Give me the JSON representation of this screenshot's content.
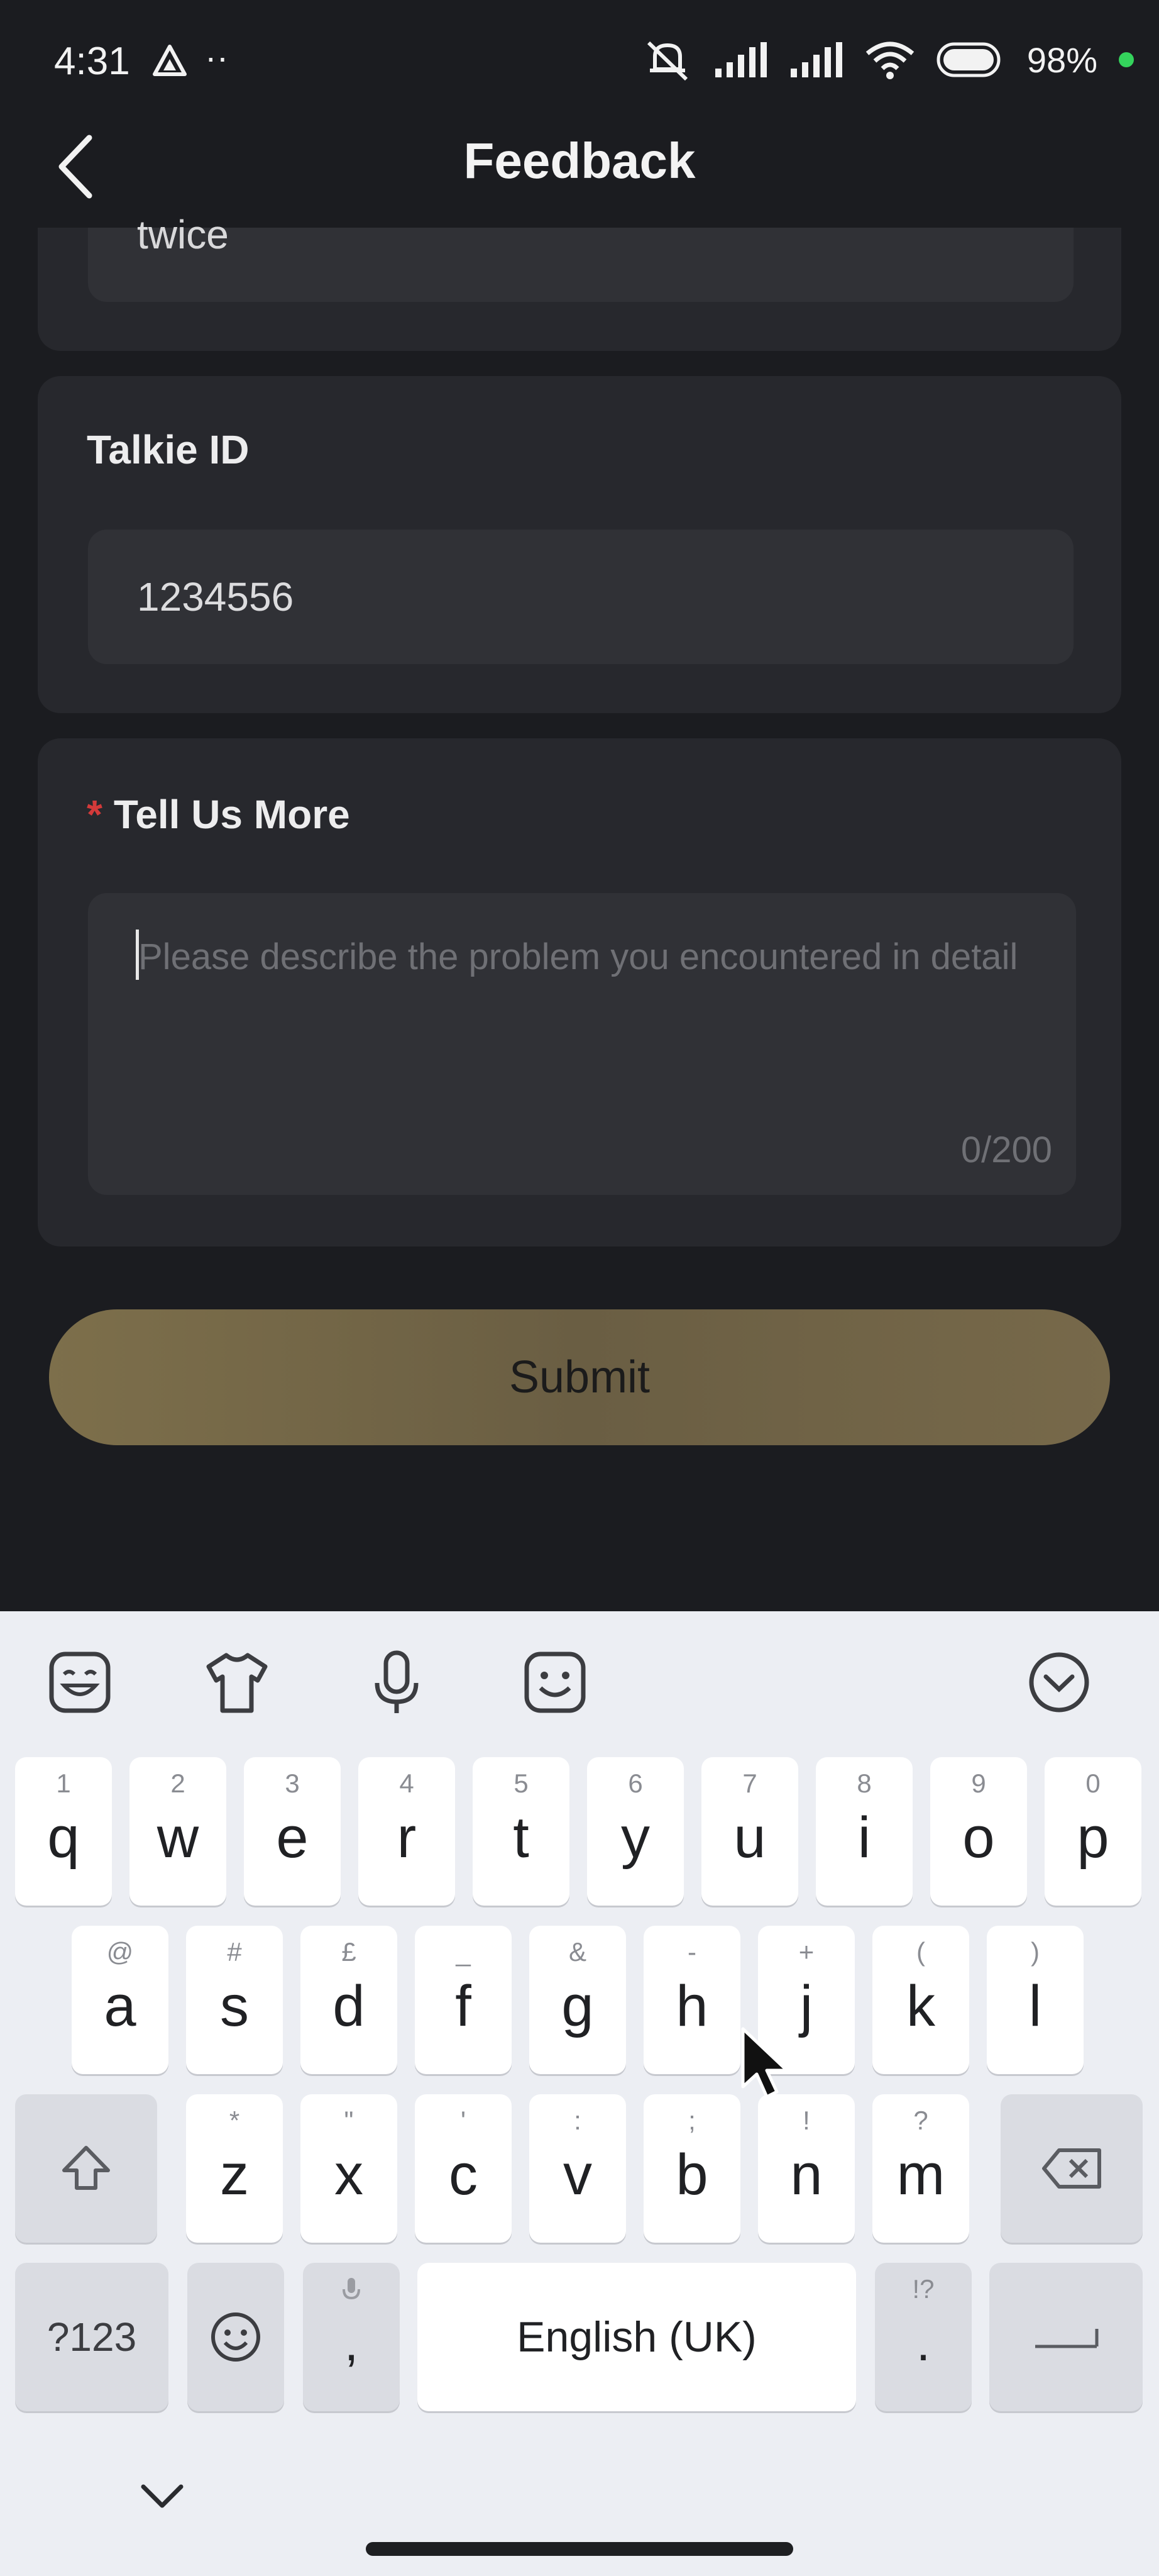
{
  "status_bar": {
    "time": "4:31",
    "dots": "··",
    "battery": "98%"
  },
  "header": {
    "title": "Feedback"
  },
  "prev_field": {
    "value": "twice"
  },
  "talkie": {
    "label": "Talkie ID",
    "value": "1234556"
  },
  "more": {
    "required_mark": "*",
    "label": "Tell Us More",
    "placeholder": "Please describe the problem you encountered in detail",
    "counter": "0/200"
  },
  "submit": {
    "label": "Submit"
  },
  "keyboard": {
    "row1": [
      {
        "k": "q",
        "h": "1"
      },
      {
        "k": "w",
        "h": "2"
      },
      {
        "k": "e",
        "h": "3"
      },
      {
        "k": "r",
        "h": "4"
      },
      {
        "k": "t",
        "h": "5"
      },
      {
        "k": "y",
        "h": "6"
      },
      {
        "k": "u",
        "h": "7"
      },
      {
        "k": "i",
        "h": "8"
      },
      {
        "k": "o",
        "h": "9"
      },
      {
        "k": "p",
        "h": "0"
      }
    ],
    "row2": [
      {
        "k": "a",
        "h": "@"
      },
      {
        "k": "s",
        "h": "#"
      },
      {
        "k": "d",
        "h": "£"
      },
      {
        "k": "f",
        "h": "_"
      },
      {
        "k": "g",
        "h": "&"
      },
      {
        "k": "h",
        "h": "-"
      },
      {
        "k": "j",
        "h": "+"
      },
      {
        "k": "k",
        "h": "("
      },
      {
        "k": "l",
        "h": ")"
      }
    ],
    "row3": [
      {
        "k": "z",
        "h": "*"
      },
      {
        "k": "x",
        "h": "\""
      },
      {
        "k": "c",
        "h": "'"
      },
      {
        "k": "v",
        "h": ":"
      },
      {
        "k": "b",
        "h": ";"
      },
      {
        "k": "n",
        "h": "!"
      },
      {
        "k": "m",
        "h": "?"
      }
    ],
    "symbols_key": "?123",
    "comma_key": ",",
    "space_label": "English (UK)",
    "period_key": ".",
    "period_hint": "!?"
  }
}
